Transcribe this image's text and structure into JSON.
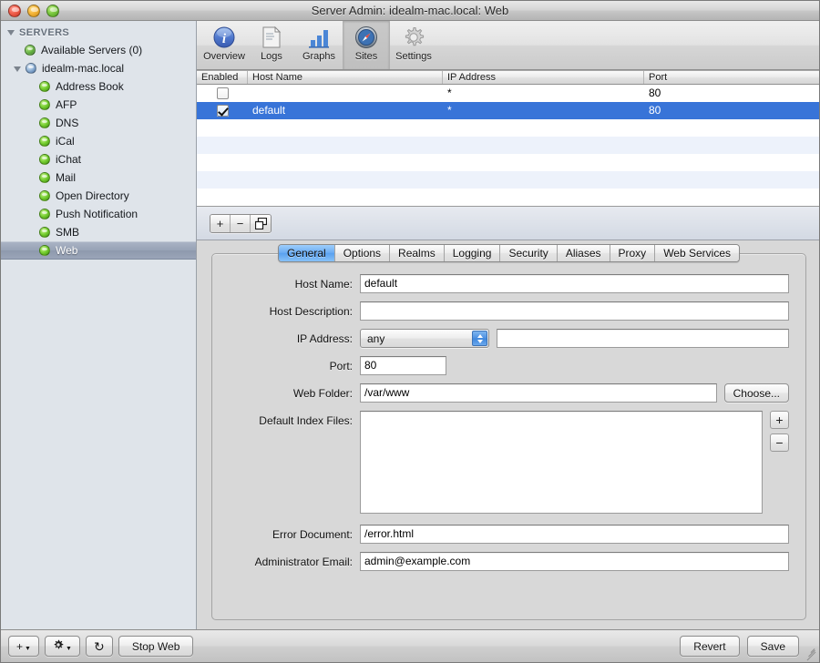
{
  "window": {
    "title": "Server Admin: idealm-mac.local: Web"
  },
  "sidebar": {
    "group_header": "SERVERS",
    "items": [
      {
        "label": "Available Servers (0)",
        "icon": "globe-green-icon",
        "indent": 1,
        "selected": false
      },
      {
        "label": "idealm-mac.local",
        "icon": "globe-blue-icon",
        "indent": 1,
        "selected": false,
        "disclosure": "open"
      },
      {
        "label": "Address Book",
        "icon": "status-green-dot-icon",
        "indent": 2,
        "selected": false
      },
      {
        "label": "AFP",
        "icon": "status-green-dot-icon",
        "indent": 2,
        "selected": false
      },
      {
        "label": "DNS",
        "icon": "status-green-dot-icon",
        "indent": 2,
        "selected": false
      },
      {
        "label": "iCal",
        "icon": "status-green-dot-icon",
        "indent": 2,
        "selected": false
      },
      {
        "label": "iChat",
        "icon": "status-green-dot-icon",
        "indent": 2,
        "selected": false
      },
      {
        "label": "Mail",
        "icon": "status-green-dot-icon",
        "indent": 2,
        "selected": false
      },
      {
        "label": "Open Directory",
        "icon": "status-green-dot-icon",
        "indent": 2,
        "selected": false
      },
      {
        "label": "Push Notification",
        "icon": "status-green-dot-icon",
        "indent": 2,
        "selected": false
      },
      {
        "label": "SMB",
        "icon": "status-green-dot-icon",
        "indent": 2,
        "selected": false
      },
      {
        "label": "Web",
        "icon": "status-green-dot-icon",
        "indent": 2,
        "selected": true
      }
    ]
  },
  "toolbar": {
    "items": [
      {
        "label": "Overview",
        "icon": "info-circle-icon",
        "active": false
      },
      {
        "label": "Logs",
        "icon": "document-icon",
        "active": false
      },
      {
        "label": "Graphs",
        "icon": "bar-chart-icon",
        "active": false
      },
      {
        "label": "Sites",
        "icon": "compass-icon",
        "active": true
      },
      {
        "label": "Settings",
        "icon": "gear-icon",
        "active": false
      }
    ]
  },
  "sites_table": {
    "columns": [
      "Enabled",
      "Host Name",
      "IP Address",
      "Port"
    ],
    "rows": [
      {
        "enabled": false,
        "host_name": "",
        "ip_address": "*",
        "port": "80",
        "selected": false
      },
      {
        "enabled": true,
        "host_name": "default",
        "ip_address": "*",
        "port": "80",
        "selected": true
      }
    ],
    "empty_row_count": 5
  },
  "list_toolbar": {
    "add_label": "+",
    "remove_label": "−",
    "duplicate_label": "duplicate-icon"
  },
  "tabs": [
    {
      "label": "General",
      "active": true
    },
    {
      "label": "Options",
      "active": false
    },
    {
      "label": "Realms",
      "active": false
    },
    {
      "label": "Logging",
      "active": false
    },
    {
      "label": "Security",
      "active": false
    },
    {
      "label": "Aliases",
      "active": false
    },
    {
      "label": "Proxy",
      "active": false
    },
    {
      "label": "Web Services",
      "active": false
    }
  ],
  "general_form": {
    "host_name": {
      "label": "Host Name:",
      "value": "default"
    },
    "host_description": {
      "label": "Host Description:",
      "value": ""
    },
    "ip_address": {
      "label": "IP Address:",
      "selected_option": "any",
      "options": [
        "any"
      ],
      "extra_value": ""
    },
    "port": {
      "label": "Port:",
      "value": "80"
    },
    "web_folder": {
      "label": "Web Folder:",
      "value": "/var/www",
      "choose_label": "Choose..."
    },
    "default_index_files": {
      "label": "Default Index Files:",
      "items": [],
      "add_label": "+",
      "remove_label": "−"
    },
    "error_document": {
      "label": "Error Document:",
      "value": "/error.html"
    },
    "administrator_email": {
      "label": "Administrator Email:",
      "value": "admin@example.com"
    }
  },
  "bottom_bar": {
    "add_label": "+",
    "action_label": "gear-icon",
    "refresh_label": "↻",
    "service_toggle_label": "Stop Web",
    "revert_label": "Revert",
    "save_label": "Save"
  },
  "colors": {
    "selection_blue": "#3874d8",
    "row_alt": "#edf2fb",
    "sidebar_bg": "#dfe4ea",
    "panel_bg": "#d8d8d8",
    "tab_active": "#6eaef3"
  }
}
